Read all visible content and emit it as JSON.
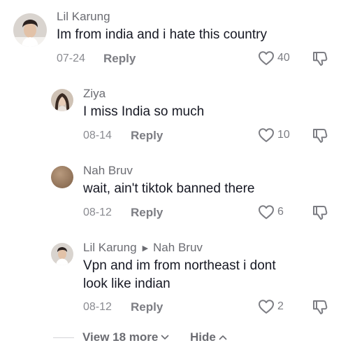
{
  "comments": [
    {
      "username": "Lil Karung",
      "reply_to": "",
      "text_lines": [
        "Im from india and i hate this country"
      ],
      "date": "07-24",
      "reply_label": "Reply",
      "likes": "40",
      "avatar_icon": "avatar-photo-boy"
    },
    {
      "username": "Ziya",
      "reply_to": "",
      "text_lines": [
        "I miss India so much"
      ],
      "date": "08-14",
      "reply_label": "Reply",
      "likes": "10",
      "avatar_icon": "avatar-photo-girl"
    },
    {
      "username": "Nah Bruv",
      "reply_to": "",
      "text_lines": [
        "wait, ain't tiktok banned there"
      ],
      "date": "08-12",
      "reply_label": "Reply",
      "likes": "6",
      "avatar_icon": "avatar-default"
    },
    {
      "username": "Lil Karung",
      "reply_to": "Nah Bruv",
      "text_lines": [
        "Vpn and im from northeast i dont",
        "look like indian"
      ],
      "date": "08-12",
      "reply_label": "Reply",
      "likes": "2",
      "avatar_icon": "avatar-photo-boy"
    }
  ],
  "footer": {
    "view_more_label": "View 18 more",
    "hide_label": "Hide"
  },
  "colors": {
    "text": "#161823",
    "muted": "#6b6c72",
    "icon": "#7c7d83"
  }
}
